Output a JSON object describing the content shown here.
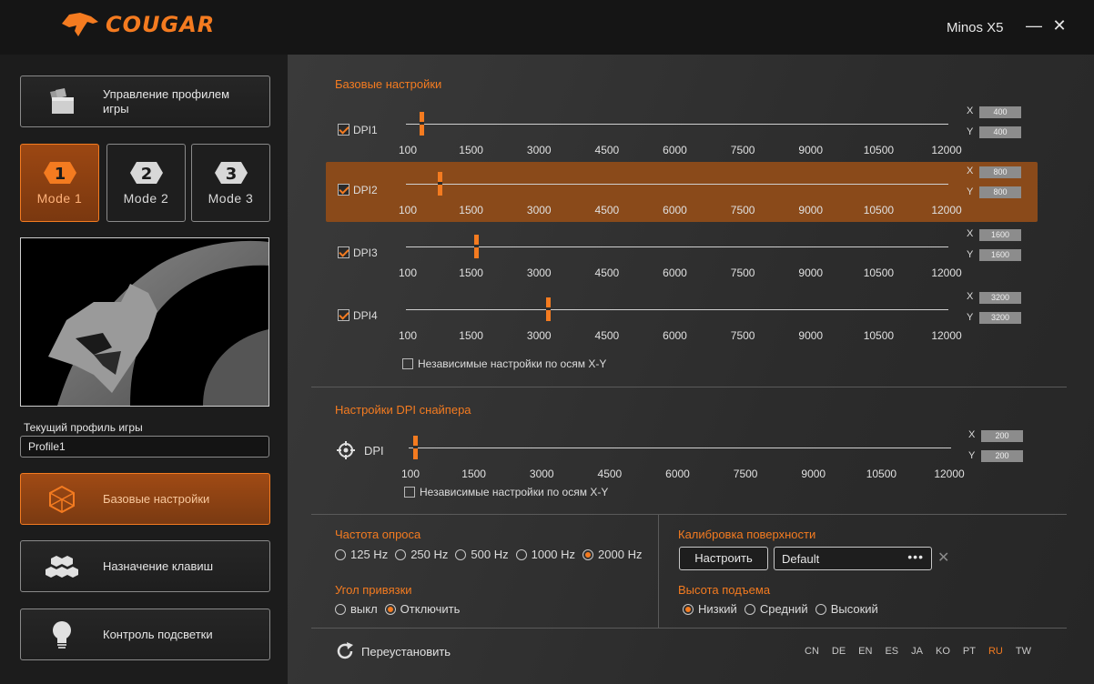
{
  "app": {
    "logo_text": "COUGAR",
    "device_name": "Minos X5",
    "minimize_label": "—",
    "close_label": "✕"
  },
  "sidebar": {
    "profile_manage_label": "Управление профилем игры",
    "modes": [
      {
        "label": "Mode 1",
        "number": "1",
        "active": true
      },
      {
        "label": "Mode 2",
        "number": "2",
        "active": false
      },
      {
        "label": "Mode 3",
        "number": "3",
        "active": false
      }
    ],
    "current_profile_label": "Текущий профиль игры",
    "current_profile_value": "Profile1",
    "nav": [
      {
        "label": "Базовые настройки",
        "icon": "cube-icon",
        "active": true
      },
      {
        "label": "Назначение клавиш",
        "icon": "hexagons-icon",
        "active": false
      },
      {
        "label": "Контроль подсветки",
        "icon": "lightbulb-icon",
        "active": false
      }
    ]
  },
  "basic": {
    "title": "Базовые настройки",
    "tick_labels": [
      "100",
      "1500",
      "3000",
      "4500",
      "6000",
      "7500",
      "9000",
      "10500",
      "12000"
    ],
    "dpi_levels": [
      {
        "name": "DPI1",
        "checked": true,
        "x": "400",
        "y": "400",
        "value": 400,
        "highlighted": false
      },
      {
        "name": "DPI2",
        "checked": true,
        "x": "800",
        "y": "800",
        "value": 800,
        "highlighted": true
      },
      {
        "name": "DPI3",
        "checked": true,
        "x": "1600",
        "y": "1600",
        "value": 1600,
        "highlighted": false
      },
      {
        "name": "DPI4",
        "checked": true,
        "x": "3200",
        "y": "3200",
        "value": 3200,
        "highlighted": false
      }
    ],
    "axis_x_label": "X",
    "axis_y_label": "Y",
    "independent_xy_label": "Независимые настройки по осям X-Y"
  },
  "sniper": {
    "title": "Настройки DPI снайпера",
    "dpi_label": "DPI",
    "x": "200",
    "y": "200",
    "value": 200,
    "independent_xy_label": "Независимые настройки по осям X-Y"
  },
  "polling": {
    "title": "Частота опроса",
    "options": [
      "125 Hz",
      "250 Hz",
      "500 Hz",
      "1000 Hz",
      "2000 Hz"
    ],
    "selected": "2000 Hz"
  },
  "snapping": {
    "title": "Угол привязки",
    "options": [
      "выкл",
      "Отключить"
    ],
    "selected": "Отключить"
  },
  "surface": {
    "title": "Калибровка поверхности",
    "setup_button": "Настроить",
    "profile_value": "Default",
    "dots": "•••"
  },
  "lift": {
    "title": "Высота подъема",
    "options": [
      "Низкий",
      "Средний",
      "Высокий"
    ],
    "selected": "Низкий"
  },
  "footer": {
    "reset_label": "Переустановить",
    "languages": [
      "CN",
      "DE",
      "EN",
      "ES",
      "JA",
      "KO",
      "PT",
      "RU",
      "TW"
    ],
    "current_language": "RU"
  },
  "colors": {
    "accent": "#f47b20",
    "highlight_row": "#8a4a1a"
  }
}
